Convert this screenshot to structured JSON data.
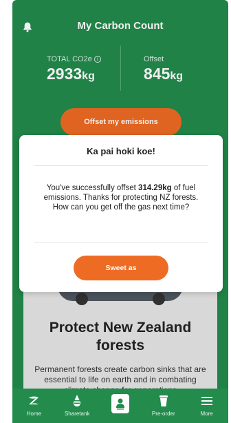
{
  "header": {
    "title": "My Carbon Count"
  },
  "stats": {
    "total_label": "TOTAL CO2e",
    "total_value": "2933",
    "total_unit": "kg",
    "offset_label": "Offset",
    "offset_value": "845",
    "offset_unit": "kg"
  },
  "main": {
    "offset_button": "Offset my emissions",
    "card_title": "Protect New Zealand forests",
    "card_body": "Permanent forests create carbon sinks that are essential to life on earth and in combating climate change for generations"
  },
  "modal": {
    "title": "Ka pai hoki koe!",
    "body_before": "You've successfully offset ",
    "body_amount": "314.29kg",
    "body_after": " of fuel emissions. Thanks for protecting NZ forests. How can you get off the gas next time?",
    "button": "Sweet as"
  },
  "nav": {
    "items": [
      {
        "label": "Home"
      },
      {
        "label": "Sharetank"
      },
      {
        "label": ""
      },
      {
        "label": "Pre-order"
      },
      {
        "label": "More"
      }
    ]
  },
  "colors": {
    "brand_green": "#238b4c",
    "accent_orange": "#ee6b24"
  }
}
